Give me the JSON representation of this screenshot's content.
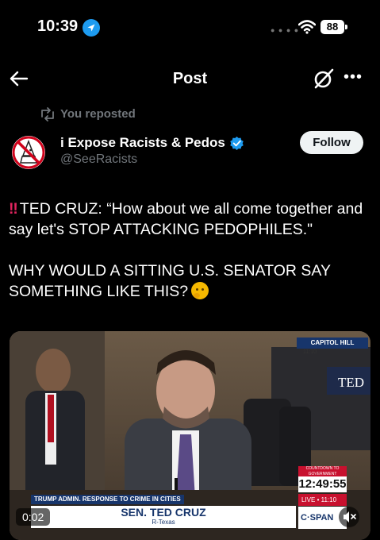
{
  "status_bar": {
    "time": "10:39",
    "battery": "88"
  },
  "header": {
    "title": "Post"
  },
  "repost": {
    "text": "You reposted"
  },
  "author": {
    "name": "i Expose Racists & Pedos",
    "handle": "@SeeRacists",
    "follow_label": "Follow"
  },
  "post": {
    "bang": "‼",
    "line1": "TED CRUZ: “How about we all come together and say let's STOP ATTACKING PEDOPHILES.\"",
    "line2": "WHY WOULD A SITTING U.S. SENATOR SAY SOMETHING LIKE THIS?"
  },
  "video": {
    "timer": "0:02",
    "chyron_topic": "TRUMP ADMIN. RESPONSE TO CRIME IN CITIES",
    "chyron_name": "SEN. TED CRUZ",
    "chyron_party": "R-Texas",
    "capitol_label": "CAPITOL HILL",
    "small_time": "11:10",
    "sign_text": "TED",
    "countdown_label": "COUNTDOWN TO GOVERNMENT SHUTDOWN",
    "countdown": "12:49:55",
    "live_label": "LIVE",
    "live_time": "11:10",
    "network": "C·SPAN"
  },
  "colors": {
    "accent": "#1d9bf0",
    "follow_bg": "#eff3f4",
    "cspan_blue": "#17356b",
    "cspan_red": "#c8102e"
  },
  "icons": [
    "location-arrow-icon",
    "wifi-icon",
    "back-arrow-icon",
    "grok-icon",
    "more-icon",
    "repost-icon",
    "verified-badge-icon",
    "mute-icon"
  ]
}
